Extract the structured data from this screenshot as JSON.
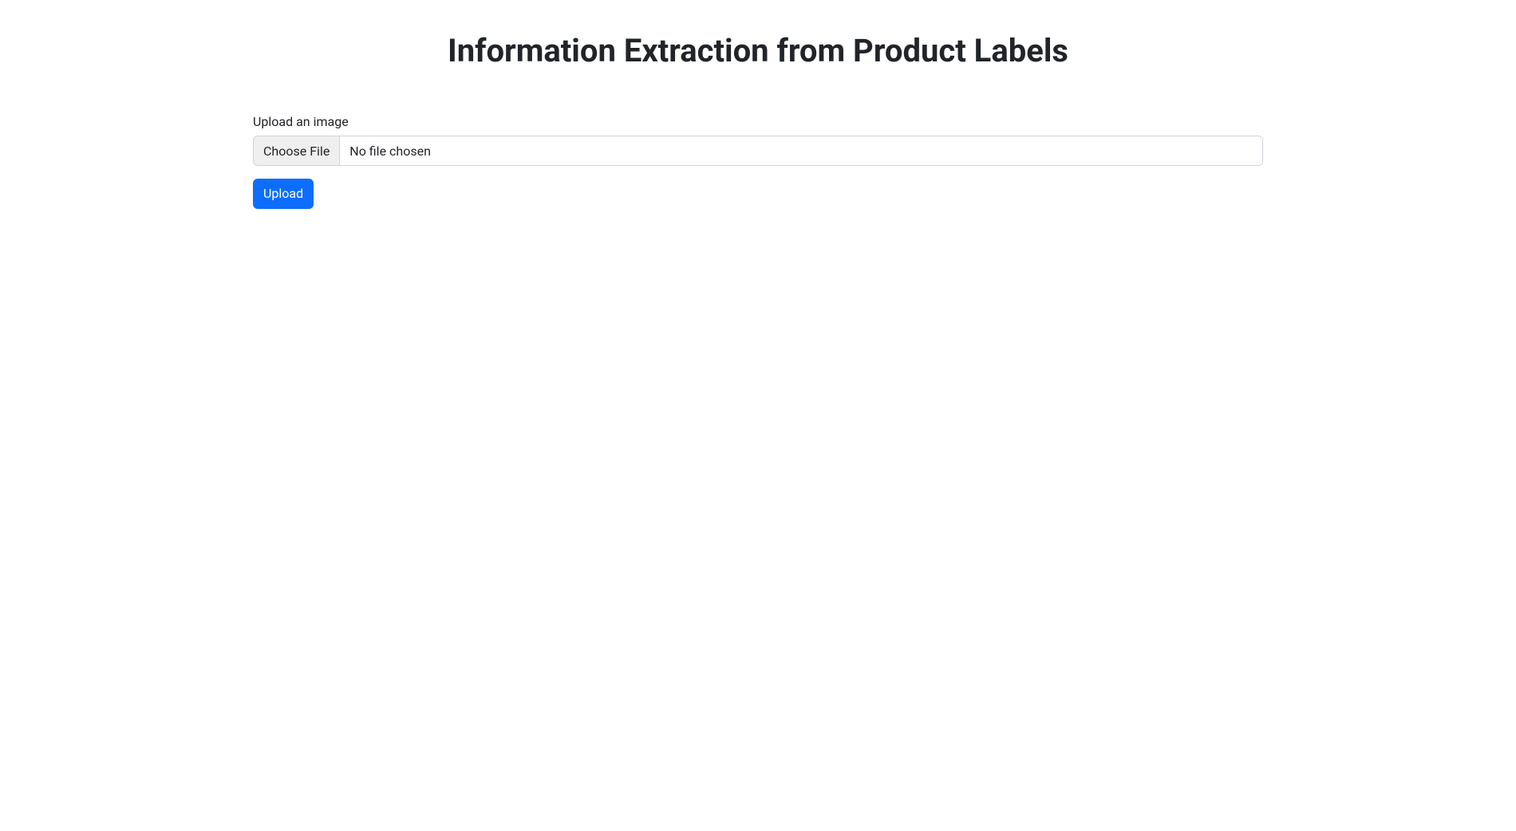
{
  "header": {
    "title": "Information Extraction from Product Labels"
  },
  "form": {
    "upload_label": "Upload an image",
    "choose_file_button_label": "Choose File",
    "file_status_text": "No file chosen",
    "submit_button_label": "Upload"
  },
  "colors": {
    "primary": "#0d6efd",
    "border": "#ced4da",
    "text": "#212529"
  }
}
